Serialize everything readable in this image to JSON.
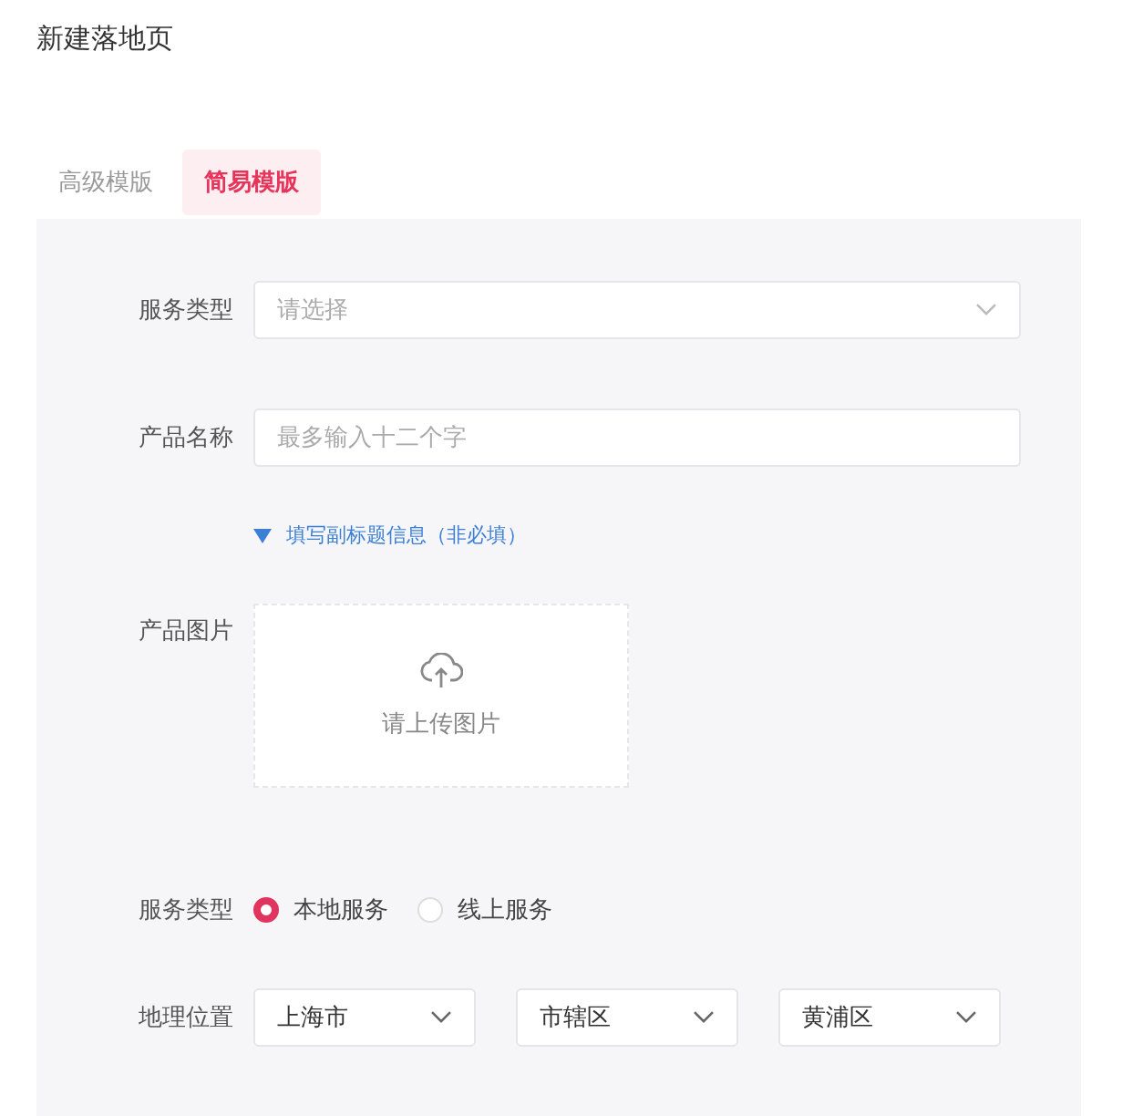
{
  "window": {
    "title": "新建落地页"
  },
  "tabs": [
    {
      "label": "高级模版",
      "selected": false
    },
    {
      "label": "简易模版",
      "selected": true
    }
  ],
  "form": {
    "fields": [
      {
        "kind": "select",
        "label": "服务类型",
        "placeholder": "请选择"
      },
      {
        "kind": "input",
        "label": "产品名称",
        "placeholder": "最多输入十二个字"
      },
      {
        "kind": "toggle",
        "text": "填写副标题信息（非必填）",
        "expanded": false
      },
      {
        "kind": "upload",
        "label": "产品图片",
        "hint": "请上传图片"
      },
      {
        "kind": "radio",
        "label": "服务类型",
        "options": [
          {
            "label": "本地服务",
            "selected": true
          },
          {
            "label": "线上服务",
            "selected": false
          }
        ]
      },
      {
        "kind": "cascade",
        "label": "地理位置",
        "values": [
          "上海市",
          "市辖区",
          "黄浦区"
        ]
      }
    ]
  }
}
